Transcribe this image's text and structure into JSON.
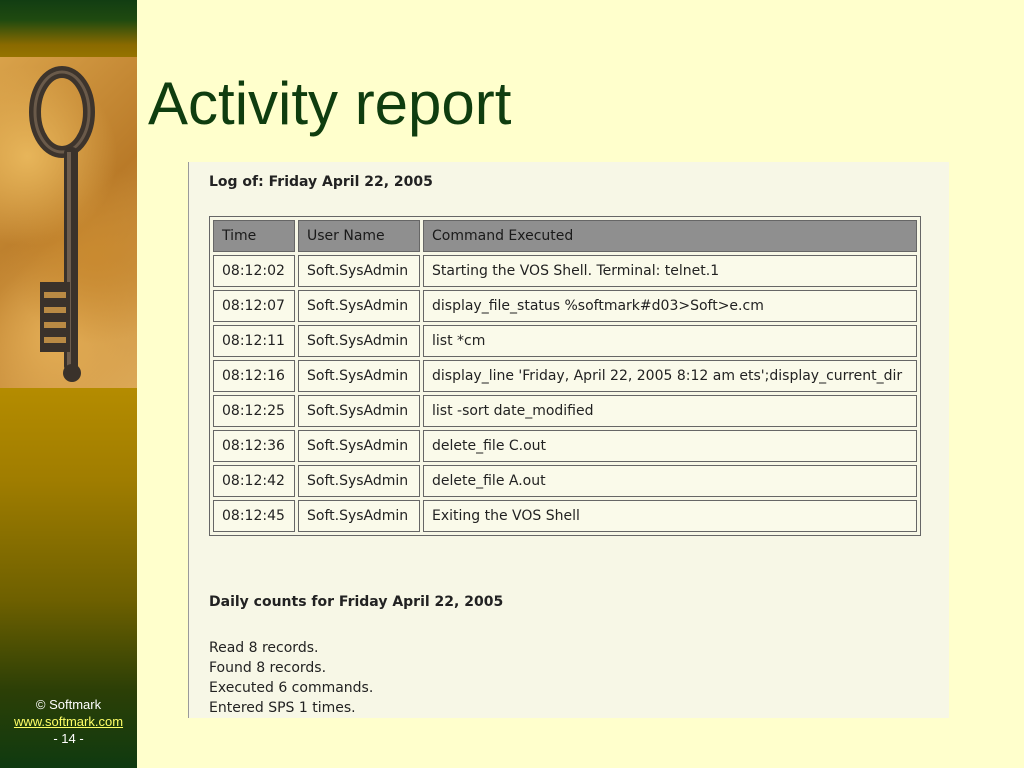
{
  "slide": {
    "title": "Activity report",
    "footer": {
      "copyright": "© Softmark",
      "website": "www.softmark.com",
      "page": "- 14 -"
    }
  },
  "report": {
    "log_heading": "Log of: Friday April 22, 2005",
    "columns": [
      "Time",
      "User Name",
      "Command Executed"
    ],
    "rows": [
      {
        "time": "08:12:02",
        "user": "Soft.SysAdmin",
        "command": "Starting the VOS Shell. Terminal: telnet.1"
      },
      {
        "time": "08:12:07",
        "user": "Soft.SysAdmin",
        "command": "display_file_status %softmark#d03>Soft>e.cm"
      },
      {
        "time": "08:12:11",
        "user": "Soft.SysAdmin",
        "command": "list *cm"
      },
      {
        "time": "08:12:16",
        "user": "Soft.SysAdmin",
        "command": "display_line 'Friday, April 22, 2005 8:12 am ets';display_current_dir"
      },
      {
        "time": "08:12:25",
        "user": "Soft.SysAdmin",
        "command": "list -sort date_modified"
      },
      {
        "time": "08:12:36",
        "user": "Soft.SysAdmin",
        "command": "delete_file C.out"
      },
      {
        "time": "08:12:42",
        "user": "Soft.SysAdmin",
        "command": "delete_file A.out"
      },
      {
        "time": "08:12:45",
        "user": "Soft.SysAdmin",
        "command": "Exiting the VOS Shell"
      }
    ],
    "counts_heading": "Daily counts for Friday April 22, 2005",
    "counts": [
      "Read 8 records.",
      "Found 8 records.",
      "Executed 6 commands.",
      "Entered SPS 1 times."
    ]
  },
  "colors": {
    "slide_background": "#ffffcc",
    "title_color": "#0f3d0f",
    "header_row": "#8f8f8f",
    "link": "#ffff66"
  },
  "icons": {
    "sidebar_image": "old-key-icon"
  }
}
